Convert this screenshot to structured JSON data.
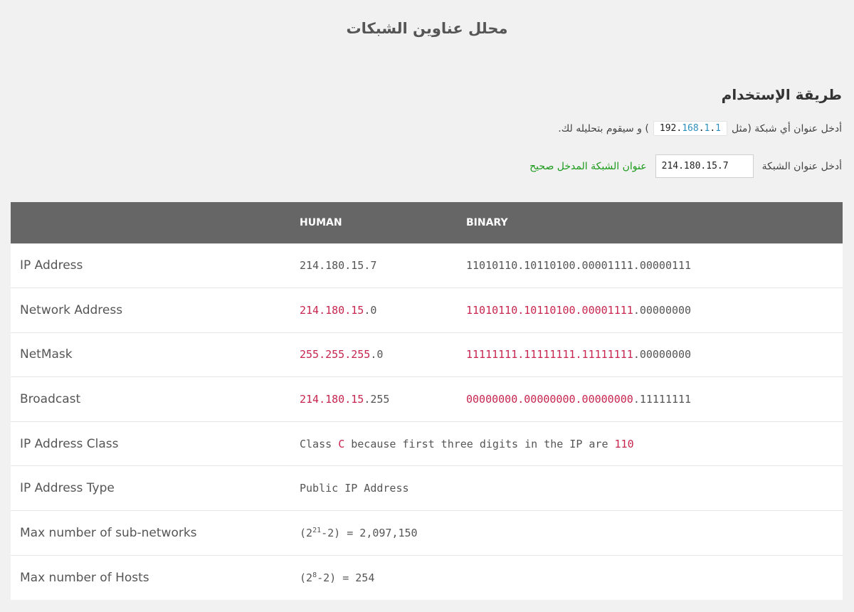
{
  "page": {
    "title": "محلل عناوين الشبكات"
  },
  "usage": {
    "heading": "طريقة الإستخدام",
    "instr_before": "أدخل عنوان أي شبكة (مثل",
    "instr_after": ") و سيقوم بتحليله لك.",
    "example": {
      "oct1": "192",
      "oct2": "168",
      "oct3": "1",
      "oct4": "1"
    }
  },
  "form": {
    "label": "أدخل عنوان الشبكة",
    "value": "214.180.15.7",
    "status": "عنوان الشبكة المدخل صحيح"
  },
  "table": {
    "headers": {
      "label": "",
      "human": "HUMAN",
      "binary": "BINARY"
    },
    "ip": {
      "label": "IP Address",
      "human": "214.180.15.7",
      "binary": "11010110.10110100.00001111.00000111"
    },
    "network": {
      "label": "Network Address",
      "human_net": "214.180.15",
      "human_host": ".0",
      "binary_net": "11010110.10110100.00001111",
      "binary_host": ".00000000"
    },
    "netmask": {
      "label": "NetMask",
      "human_net": "255.255.255",
      "human_host": ".0",
      "binary_net": "11111111.11111111.11111111",
      "binary_host": ".00000000"
    },
    "broadcast": {
      "label": "Broadcast",
      "human_net": "214.180.15",
      "human_host": ".255",
      "binary_net": "00000000.00000000.00000000",
      "binary_host": ".11111111"
    },
    "class": {
      "label": "IP Address Class",
      "prefix": "Class ",
      "letter": "C",
      "middle": " because first three digits in the IP are ",
      "bits": "110"
    },
    "type": {
      "label": "IP Address Type",
      "value": "Public IP Address"
    },
    "subnets": {
      "label": "Max number of sub-networks",
      "base": "(2",
      "exp": "21",
      "rest": "-2) = 2,097,150"
    },
    "hosts": {
      "label": "Max number of Hosts",
      "base": "(2",
      "exp": "8",
      "rest": "-2) = 254"
    }
  },
  "colors": {
    "header_bg": "#666666",
    "highlight_red": "#c7254e",
    "valid_green": "#1a9a1a",
    "page_bg": "#f1f1f1"
  }
}
